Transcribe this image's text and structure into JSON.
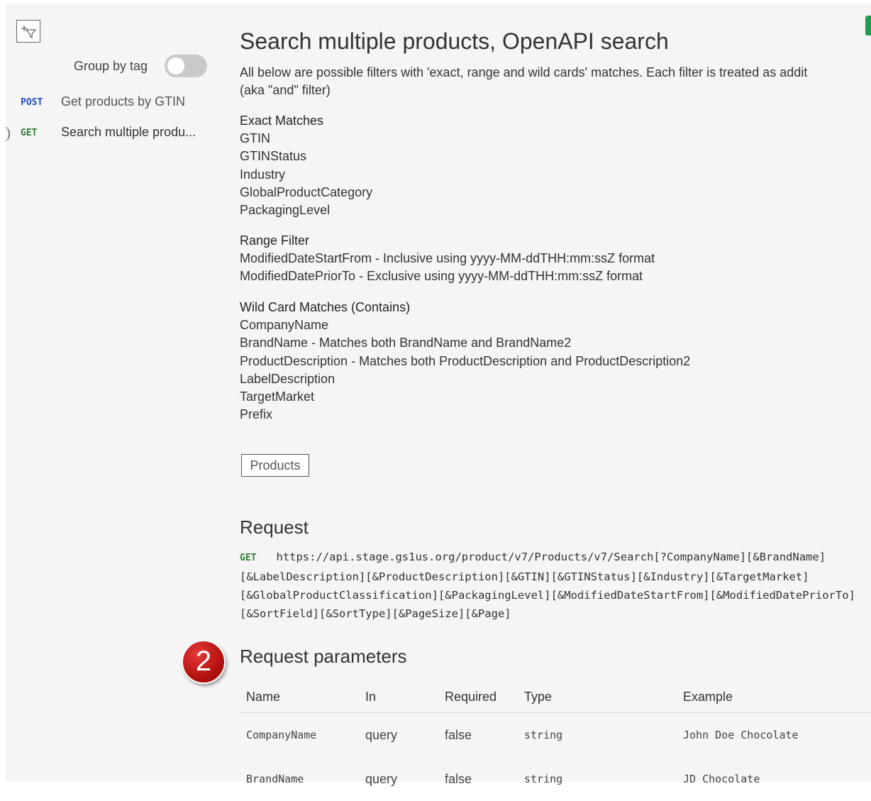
{
  "sidebar": {
    "group_by_tag_label": "Group by tag",
    "group_by_tag_on": false,
    "items": [
      {
        "method": "POST",
        "label": "Get products by GTIN"
      },
      {
        "method": "GET",
        "label": "Search multiple produ..."
      }
    ]
  },
  "operation": {
    "title": "Search multiple products, OpenAPI search",
    "description_line1": "All below are possible filters with 'exact, range and wild cards' matches. Each filter is treated as addit",
    "description_line2": "(aka \"and\" filter)",
    "exact": {
      "heading": "Exact Matches",
      "items": [
        "GTIN",
        "GTINStatus",
        "Industry",
        "GlobalProductCategory",
        "PackagingLevel"
      ]
    },
    "range": {
      "heading": "Range Filter",
      "items": [
        "ModifiedDateStartFrom - Inclusive using yyyy-MM-ddTHH:mm:ssZ format",
        "ModifiedDatePriorTo - Exclusive using yyyy-MM-ddTHH:mm:ssZ format"
      ]
    },
    "wildcard": {
      "heading": "Wild Card Matches (Contains)",
      "items": [
        "CompanyName",
        "BrandName - Matches both BrandName and BrandName2",
        "ProductDescription - Matches both ProductDescription and ProductDescription2",
        "LabelDescription",
        "TargetMarket",
        "Prefix"
      ]
    },
    "tag": "Products"
  },
  "request": {
    "heading": "Request",
    "method": "GET",
    "url_lines": [
      "https://api.stage.gs1us.org/product/v7/Products/v7/Search[?CompanyName][&BrandName]",
      "[&LabelDescription][&ProductDescription][&GTIN][&GTINStatus][&Industry][&TargetMarket]",
      "[&GlobalProductClassification][&PackagingLevel][&ModifiedDateStartFrom][&ModifiedDatePriorTo]",
      "[&SortField][&SortType][&PageSize][&Page]"
    ]
  },
  "params": {
    "heading": "Request parameters",
    "badge": "2",
    "columns": [
      "Name",
      "In",
      "Required",
      "Type",
      "Example"
    ],
    "rows": [
      {
        "name": "CompanyName",
        "in": "query",
        "required": "false",
        "type": "string",
        "example": "John Doe Chocolate"
      },
      {
        "name": "BrandName",
        "in": "query",
        "required": "false",
        "type": "string",
        "example": "JD Chocolate"
      }
    ]
  },
  "colors": {
    "post": "#1e4cc2",
    "get": "#2f7d32",
    "badge": "#c0140f",
    "accent_tag": "#1f9f4a"
  }
}
